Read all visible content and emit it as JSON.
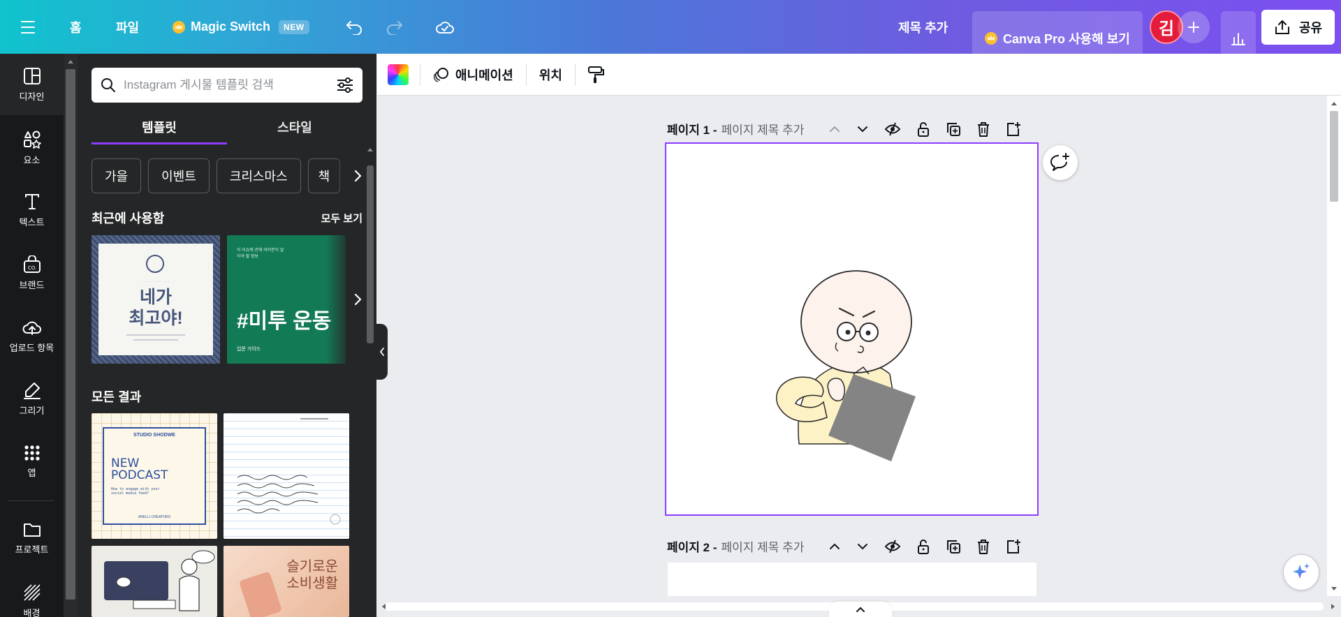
{
  "topbar": {
    "home": "홈",
    "file": "파일",
    "magic_switch": "Magic Switch",
    "new_badge": "NEW",
    "add_title": "제목 추가",
    "canva_pro": "Canva Pro 사용해 보기",
    "avatar_initial": "김",
    "share": "공유"
  },
  "rail": {
    "items": [
      {
        "label": "디자인"
      },
      {
        "label": "요소"
      },
      {
        "label": "텍스트"
      },
      {
        "label": "브랜드"
      },
      {
        "label": "업로드 항목"
      },
      {
        "label": "그리기"
      },
      {
        "label": "앱"
      },
      {
        "label": "프로젝트"
      },
      {
        "label": "배경"
      }
    ]
  },
  "panel": {
    "search_placeholder": "Instagram 게시물 템플릿 검색",
    "tabs": [
      "템플릿",
      "스타일"
    ],
    "chips": [
      "가을",
      "이벤트",
      "크리스마스",
      "책"
    ],
    "recent_title": "최근에 사용함",
    "see_all": "모두 보기",
    "all_results": "모든 결과",
    "recent": [
      {
        "big_text": "네가\n최고야!",
        "line1": "네가",
        "line2": "최고야!"
      },
      {
        "big_text": "#미투 운동",
        "small_top": "이 이슈에 관해 여러분이 알아야 할 정보",
        "footer": "입문 가이드"
      }
    ],
    "results": [
      {
        "brand": "STUDIO SHODWE",
        "title1": "NEW",
        "title2": "PODCAST",
        "sub": "How to engage with your social media feed?",
        "footer": "ARELLI CREATORS"
      },
      {
        "note": "handwritten memo"
      },
      {
        "tag": "illustration"
      },
      {
        "title1": "슬기로운",
        "title2": "소비생활"
      }
    ]
  },
  "toolbar": {
    "animation": "애니메이션",
    "position": "위치"
  },
  "canvas": {
    "page1_label": "페이지 1 -",
    "page1_title": "페이지 제목 추가",
    "page2_label": "페이지 2 -",
    "page2_title": "페이지 제목 추가"
  },
  "colors": {
    "accent": "#8b3dff",
    "rail_bg": "#18191b",
    "panel_bg": "#252627",
    "avatar": "#e21c3a",
    "canvas_bg": "#ebecf0"
  }
}
